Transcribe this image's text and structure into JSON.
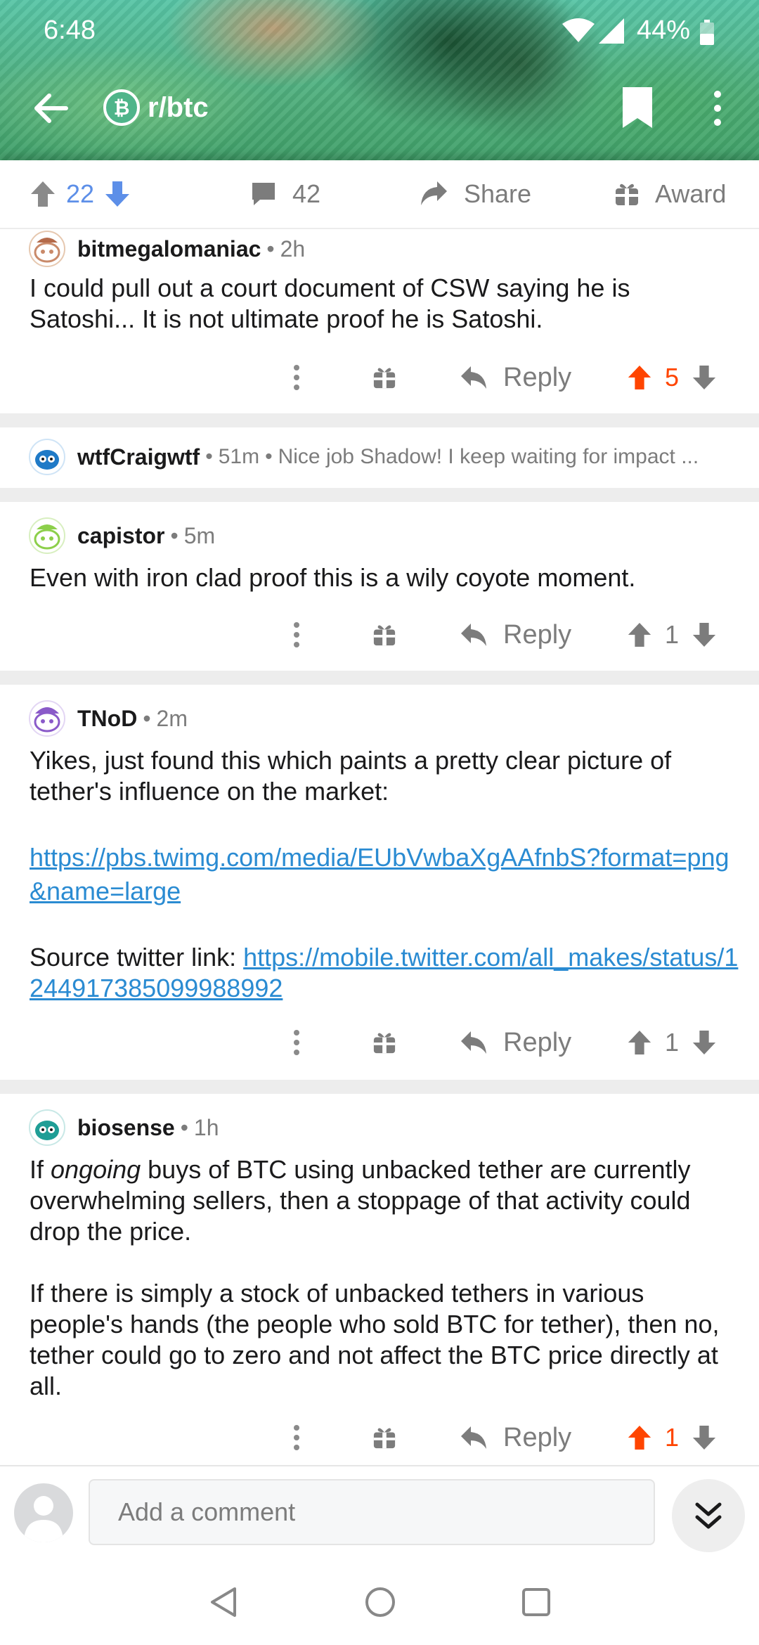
{
  "status_bar": {
    "time": "6:48",
    "battery": "44%"
  },
  "header": {
    "subreddit": "r/btc"
  },
  "post_actions": {
    "vote_count": "22",
    "comment_count": "42",
    "share_label": "Share",
    "award_label": "Award"
  },
  "comments": [
    {
      "username": "bitmegalomaniac",
      "age": "2h",
      "body": "I could pull out a court document of CSW saying he is Satoshi... It is not ultimate proof he is Satoshi.",
      "reply_label": "Reply",
      "score": "5",
      "upvoted": true
    },
    {
      "username": "wtfCraigwtf",
      "age": "51m",
      "preview": "Nice job Shadow! I keep waiting for impact ...",
      "collapsed": true
    },
    {
      "username": "capistor",
      "age": "5m",
      "body": "Even with iron clad proof this is a wily coyote moment.",
      "reply_label": "Reply",
      "score": "1",
      "upvoted": false
    },
    {
      "username": "TNoD",
      "age": "2m",
      "body_p1": "Yikes, just found this which paints a pretty clear picture of tether's influence on the market:",
      "link1": "https://pbs.twimg.com/media/EUbVwbaXgAAfnbS?format=png&name=large",
      "source_prefix": "Source twitter link: ",
      "link2": "https://mobile.twitter.com/all_makes/status/1244917385099988992",
      "reply_label": "Reply",
      "score": "1",
      "upvoted": false
    },
    {
      "username": "biosense",
      "age": "1h",
      "body_p1_pre": "If ",
      "body_p1_em": "ongoing",
      "body_p1_post": " buys of BTC using unbacked tether are currently overwhelming sellers, then a stoppage of that activity could drop the price.",
      "body_p2": "If there is simply a stock of unbacked tethers in various people's hands (the people who sold BTC for tether), then no, tether could go to zero and not affect the BTC price directly at all.",
      "reply_label": "Reply",
      "score": "1",
      "upvoted": true
    }
  ],
  "composer": {
    "placeholder": "Add a comment"
  },
  "colors": {
    "upvote_active": "#ff4500",
    "link": "#2a8bd2",
    "vote_blue": "#5d8fe8"
  },
  "icons": [
    "back-arrow-icon",
    "bitcoin-icon",
    "bookmark-icon",
    "kebab-icon",
    "upvote-icon",
    "downvote-icon",
    "comment-icon",
    "share-icon",
    "award-icon",
    "reply-icon",
    "chevron-double-down-icon"
  ]
}
